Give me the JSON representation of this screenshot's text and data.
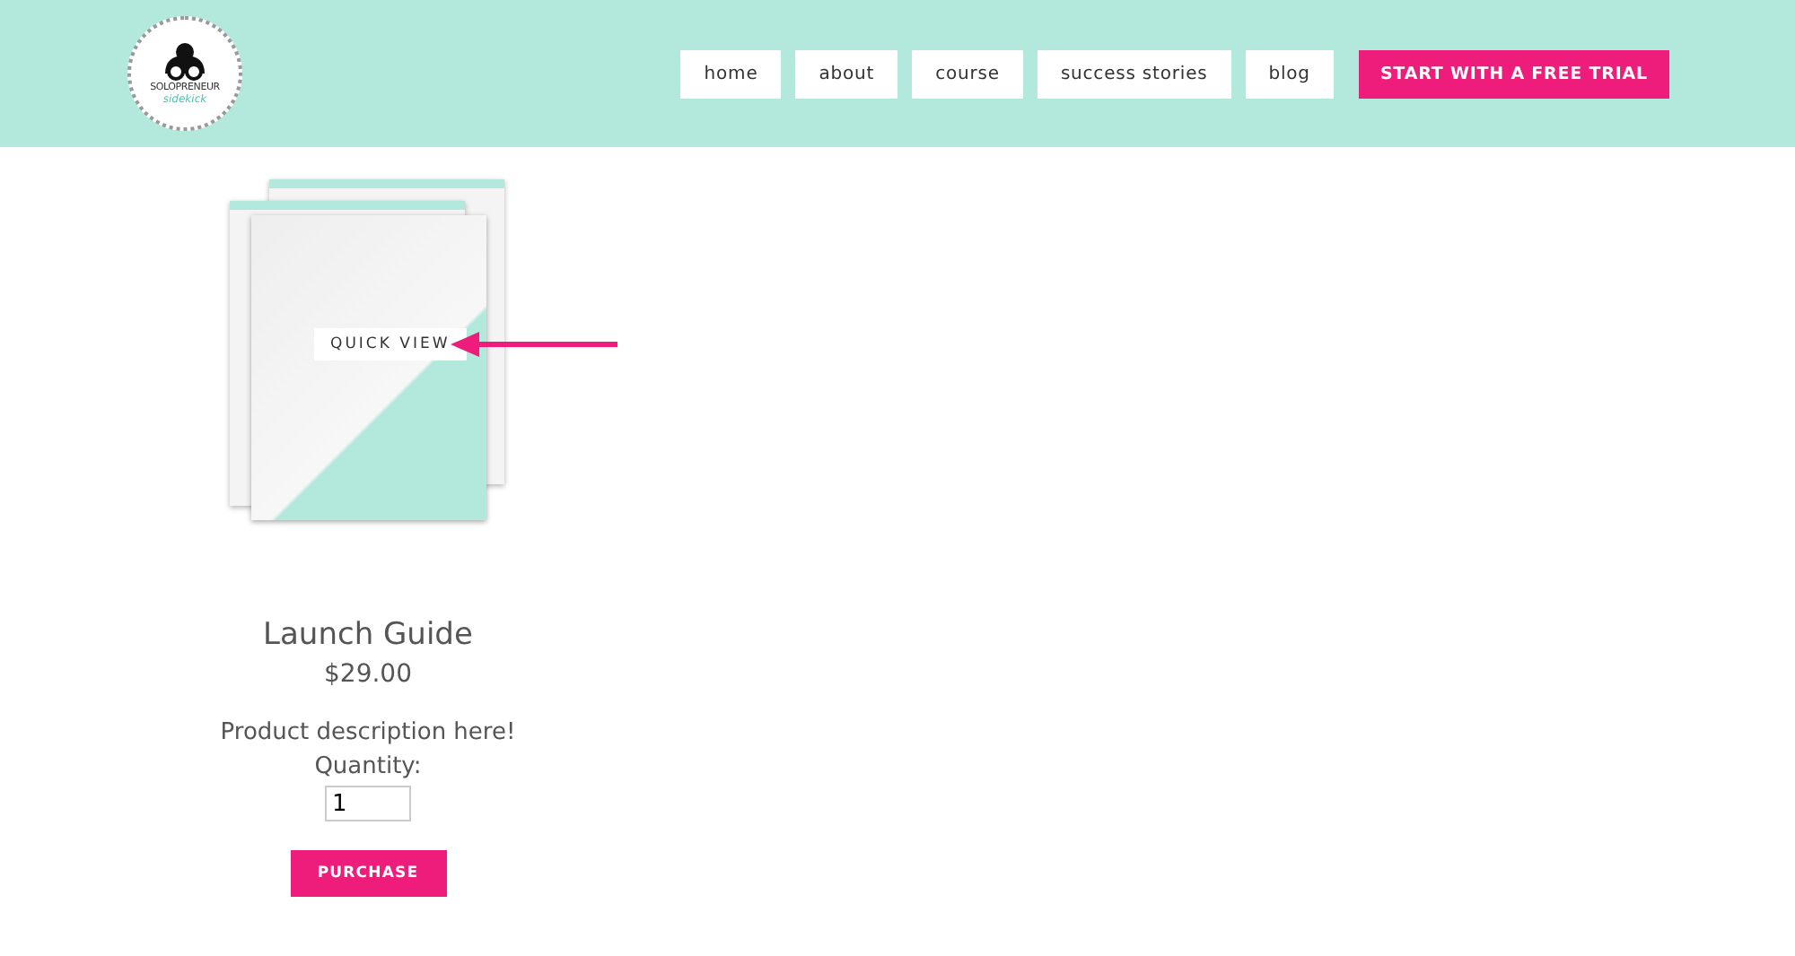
{
  "logo": {
    "title": "SOLOPRENEUR",
    "subtitle": "sidekick"
  },
  "nav": [
    {
      "label": "home",
      "kind": "link"
    },
    {
      "label": "about",
      "kind": "link"
    },
    {
      "label": "course",
      "kind": "link"
    },
    {
      "label": "success stories",
      "kind": "link"
    },
    {
      "label": "blog",
      "kind": "link"
    },
    {
      "label": "START WITH A FREE TRIAL",
      "kind": "cta"
    }
  ],
  "product": {
    "quick_view": "QUICK VIEW",
    "name": "Launch Guide",
    "price": "$29.00",
    "description": "Product description here!",
    "quantity_label": "Quantity:",
    "quantity": "1",
    "button": "PURCHASE"
  }
}
